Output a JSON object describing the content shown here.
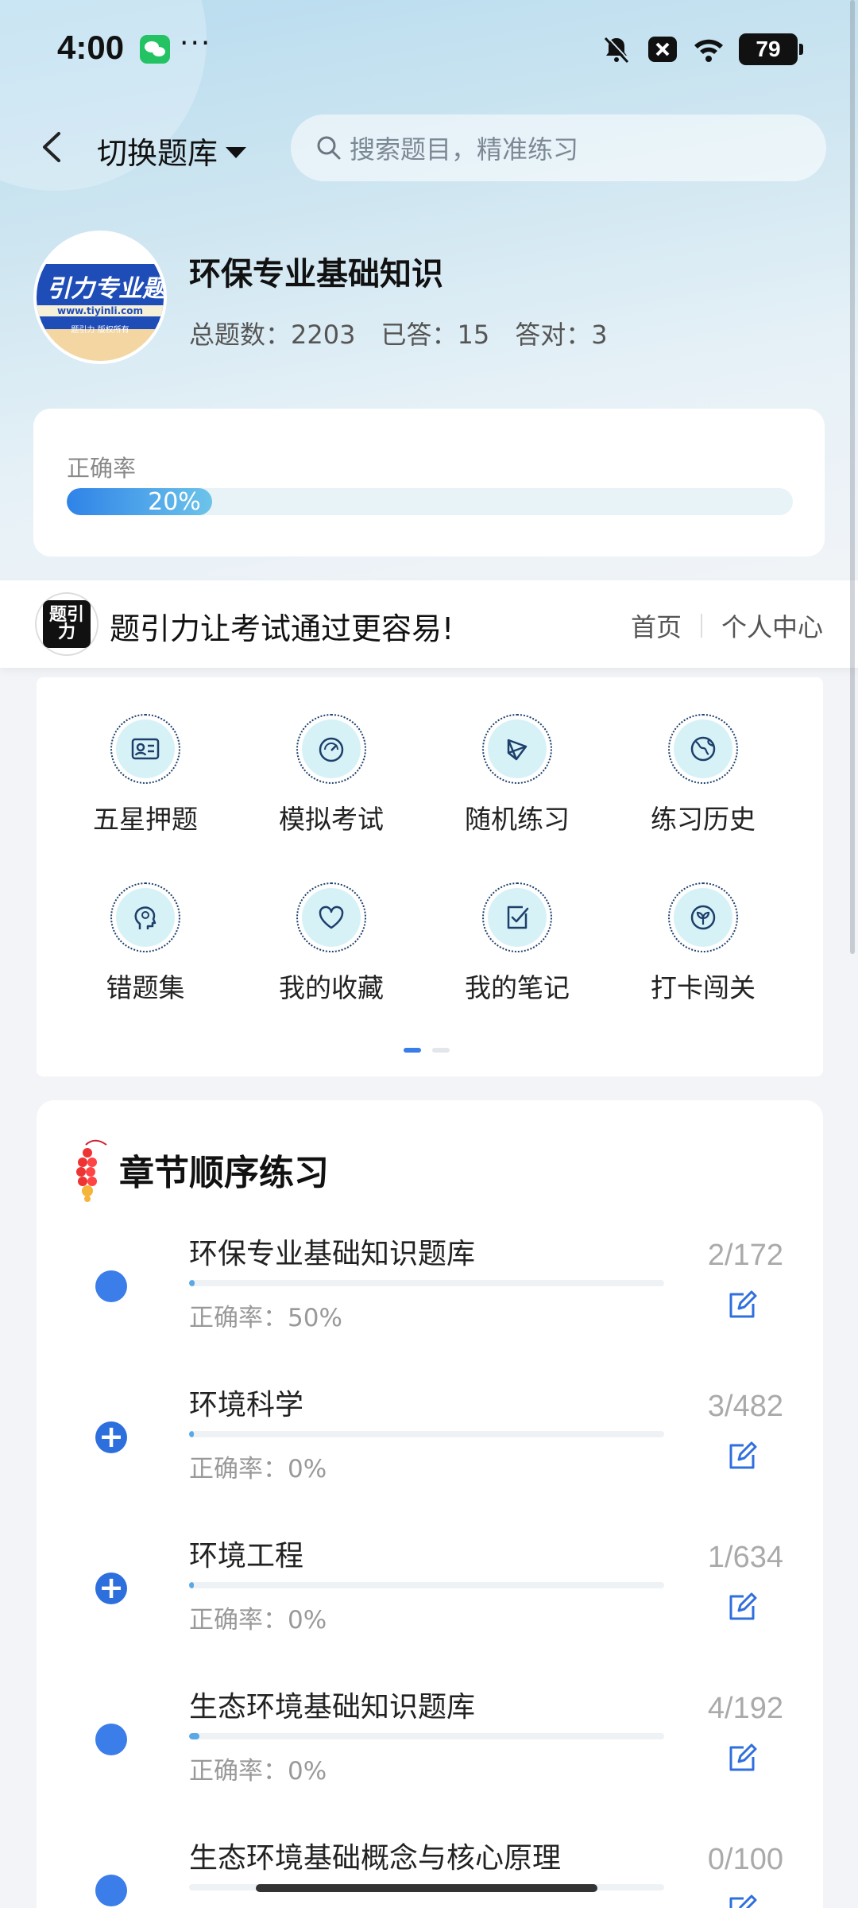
{
  "status_bar": {
    "time": "4:00",
    "dots": "···",
    "battery": "79"
  },
  "header": {
    "switch_label": "切换题库",
    "search_placeholder": "搜索题目，精准练习"
  },
  "bank": {
    "logo_text": "引力专业题",
    "logo_url": "www.tiyinli.com",
    "logo_sub": "题引力 版权所有",
    "title": "环保专业基础知识",
    "total": "总题数：2203",
    "answered": "已答：15",
    "correct": "答对：3"
  },
  "accuracy": {
    "label": "正确率",
    "value_text": "20%",
    "value": 0.2
  },
  "promo": {
    "logo_text": "题引力",
    "slogan": "题引力让考试通过更容易!",
    "home": "首页",
    "personal": "个人中心"
  },
  "functions": [
    {
      "label": "五星押题",
      "icon": "id-card-icon"
    },
    {
      "label": "模拟考试",
      "icon": "gauge-icon"
    },
    {
      "label": "随机练习",
      "icon": "network-icon"
    },
    {
      "label": "练习历史",
      "icon": "globe-icon"
    },
    {
      "label": "错题集",
      "icon": "head-icon"
    },
    {
      "label": "我的收藏",
      "icon": "heart-icon"
    },
    {
      "label": "我的笔记",
      "icon": "note-check-icon"
    },
    {
      "label": "打卡闯关",
      "icon": "leaf-badge-icon"
    }
  ],
  "chapters": {
    "title": "章节顺序练习",
    "items": [
      {
        "name": "环保专业基础知识题库",
        "rate": "正确率：50%",
        "count": "2/172",
        "progress": 0.012,
        "marker": "dot"
      },
      {
        "name": "环境科学",
        "rate": "正确率：0%",
        "count": "3/482",
        "progress": 0.006,
        "marker": "plus"
      },
      {
        "name": "环境工程",
        "rate": "正确率：0%",
        "count": "1/634",
        "progress": 0.002,
        "marker": "plus"
      },
      {
        "name": "生态环境基础知识题库",
        "rate": "正确率：0%",
        "count": "4/192",
        "progress": 0.021,
        "marker": "dot"
      },
      {
        "name": "生态环境基础概念与核心原理",
        "rate": "",
        "count": "0/100",
        "progress": 0,
        "marker": "dot"
      }
    ]
  },
  "colors": {
    "accent": "#3b7de9",
    "progress": "#5aa9e6",
    "icon_bg": "#d7f2f7"
  }
}
